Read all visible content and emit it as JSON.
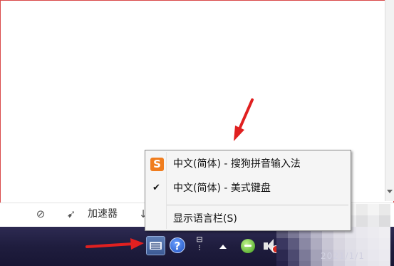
{
  "statusbar": {
    "items": [
      {
        "icon": "compass-icon"
      },
      {
        "icon": "rocket-icon"
      },
      {
        "label": "加速器"
      },
      {
        "icon": "download-arrow-icon"
      }
    ]
  },
  "ime_menu": {
    "items": [
      {
        "icon": "sogou-icon",
        "icon_glyph": "S",
        "label": "中文(简体) - 搜狗拼音输入法",
        "checked": false
      },
      {
        "icon": "check-icon",
        "icon_glyph": "✔",
        "label": "中文(简体) - 美式键盘",
        "checked": true
      },
      {
        "icon": "",
        "label": "显示语言栏(S)",
        "checked": false
      }
    ]
  },
  "taskbar": {
    "tray_icons": [
      "keyboard-icon",
      "help-icon",
      "pen-icon",
      "show-hidden-icons-arrow",
      "network-green-icon",
      "volume-muted-icon"
    ],
    "help_glyph": "?",
    "clock_partial": "2021/1/1"
  },
  "colors": {
    "taskbar": "#221f47",
    "menu_bg": "#f5f5f5",
    "annotation_red": "#e02020",
    "sogou_orange": "#f07d1e"
  }
}
